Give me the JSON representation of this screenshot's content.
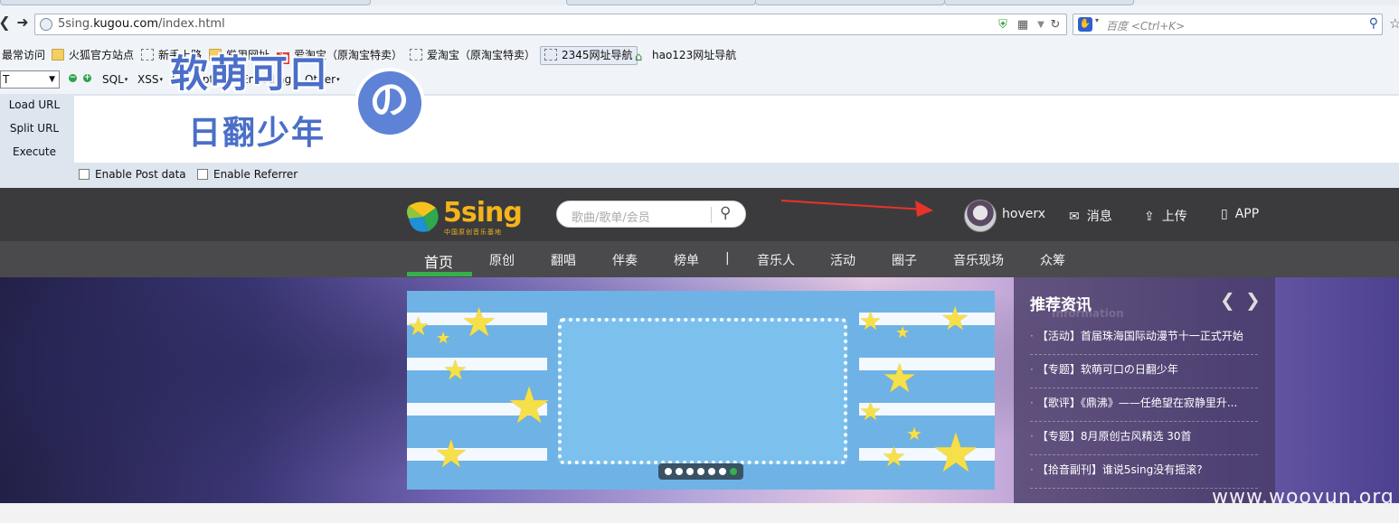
{
  "browser": {
    "url_prefix": "5sing.",
    "url_host": "kugou.com",
    "url_path": "/index.html",
    "search_placeholder": "百度 <Ctrl+K>",
    "bookmarks": [
      {
        "label": "最常访问",
        "icon": "none"
      },
      {
        "label": "火狐官方站点",
        "icon": "folder"
      },
      {
        "label": "新手上路",
        "icon": "dashed"
      },
      {
        "label": "常用网址",
        "icon": "folder"
      },
      {
        "label": "爱淘宝（原淘宝特卖）",
        "icon": "taobao"
      },
      {
        "label": "爱淘宝（原淘宝特卖）",
        "icon": "dashed"
      },
      {
        "label": "2345网址导航",
        "icon": "dashed"
      },
      {
        "label": "hao123网址导航",
        "icon": "house"
      }
    ]
  },
  "hackbar": {
    "select_value": "T",
    "menus": [
      "SQL",
      "XSS",
      "Encryption",
      "Encoding",
      "Other"
    ],
    "actions": [
      "Load URL",
      "Split URL",
      "Execute"
    ],
    "post_label": "Enable Post data",
    "referrer_label": "Enable Referrer"
  },
  "site": {
    "logo_text": "5sing",
    "logo_tagline": "中国原创音乐基地",
    "search_placeholder": "歌曲/歌单/会员",
    "username": "hoverx",
    "header_links": {
      "messages": "消息",
      "upload": "上传",
      "app": "APP"
    },
    "nav": [
      "首页",
      "原创",
      "翻唱",
      "伴奏",
      "榜单",
      "|",
      "音乐人",
      "活动",
      "圈子",
      "音乐现场",
      "众筹"
    ],
    "banner": {
      "title": "软萌可口",
      "subtitle": "日翻少年",
      "no": "の"
    },
    "news": {
      "title": "推荐资讯",
      "subtitle": "Information",
      "items": [
        "【活动】首届珠海国际动漫节十一正式开始",
        "【专题】软萌可口の日翻少年",
        "【歌评】《鼎沸》——任绝望在寂静里升...",
        "【专题】8月原创古风精选 30首",
        "【拾音副刊】谁说5sing没有摇滚?"
      ]
    }
  },
  "watermark": "www.wooyun.org",
  "colors": {
    "accent_green": "#36b04a",
    "logo_yellow": "#f4b41a",
    "header_bg": "#3b3b3d"
  }
}
